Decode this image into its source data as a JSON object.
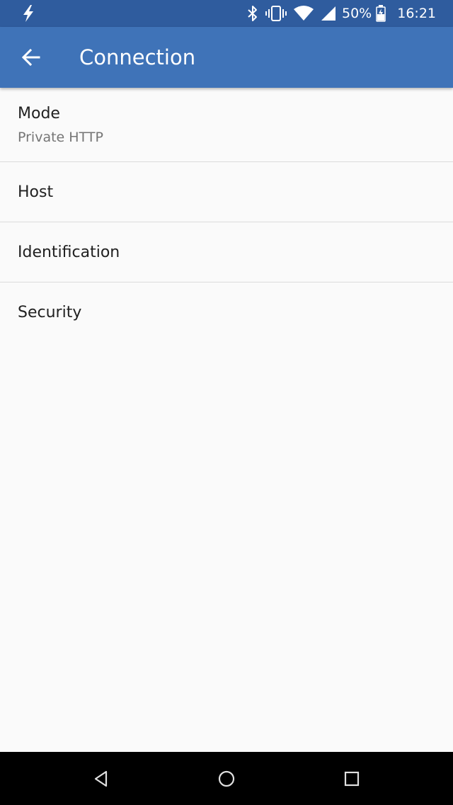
{
  "status_bar": {
    "battery_percent": "50%",
    "time": "16:21",
    "icons": [
      "flash-icon",
      "bluetooth-icon",
      "vibrate-icon",
      "wifi-icon",
      "cell-signal-icon",
      "battery-icon"
    ]
  },
  "app_bar": {
    "title": "Connection",
    "back_icon": "arrow-back-icon"
  },
  "settings": {
    "items": [
      {
        "title": "Mode",
        "summary": "Private HTTP"
      },
      {
        "title": "Host"
      },
      {
        "title": "Identification"
      },
      {
        "title": "Security"
      }
    ]
  },
  "nav_bar": {
    "icons": [
      "nav-back-icon",
      "nav-home-icon",
      "nav-recents-icon"
    ]
  },
  "colors": {
    "status_bar": "#2f5c9e",
    "app_bar": "#3f73b8",
    "background": "#fafafa",
    "divider": "#dcdcdc",
    "primary_text": "#212121",
    "secondary_text": "#757575"
  }
}
